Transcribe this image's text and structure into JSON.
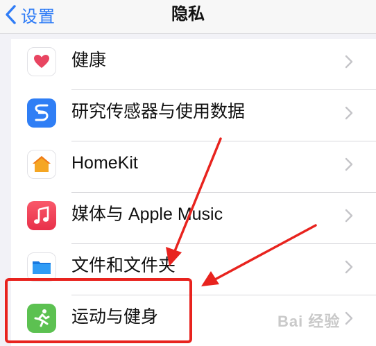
{
  "navbar": {
    "back_label": "设置",
    "title": "隐私"
  },
  "items": [
    {
      "label": "健康",
      "icon": "heart-icon",
      "color": "#e84561"
    },
    {
      "label": "研究传感器与使用数据",
      "icon": "research-sensor-icon",
      "color": "#2f7ef5"
    },
    {
      "label": "HomeKit",
      "icon": "home-icon",
      "color": "#f5a623"
    },
    {
      "label": "媒体与 Apple Music",
      "icon": "music-note-icon",
      "color": "#f0465a"
    },
    {
      "label": "文件和文件夹",
      "icon": "folder-icon",
      "color": "#1e8ef0"
    },
    {
      "label": "运动与健身",
      "icon": "fitness-runner-icon",
      "color": "#5cc151"
    }
  ],
  "annotation": {
    "highlight_color": "#e8231e"
  },
  "watermark": {
    "text": "Bai 经验"
  },
  "colors": {
    "accent": "#2f7cf6",
    "background": "#f2f2f7"
  }
}
